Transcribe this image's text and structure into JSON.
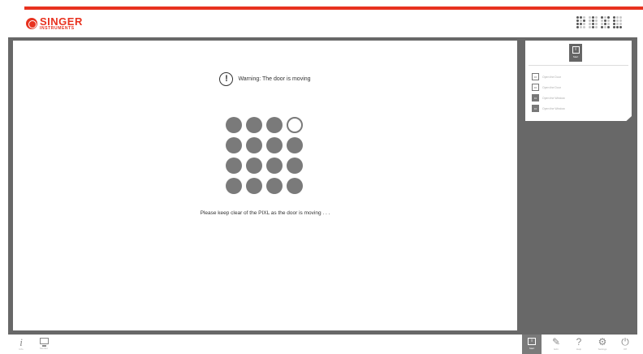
{
  "header": {
    "logo_brand": "SINGER",
    "logo_sub": "INSTRUMENTS",
    "product_logo": "PIXL"
  },
  "main": {
    "warning_icon": "exclamation-circle-icon",
    "warning_text": "Warning: The door is moving",
    "status_grid": {
      "rows": 4,
      "cols": 4,
      "empty_positions": [
        3
      ]
    },
    "message": "Please keep clear of the PIXL as the door is moving . . ."
  },
  "side_panel": {
    "tab_icon": "info-icon",
    "tab_label": "Start",
    "items": [
      {
        "label": "Open the Door",
        "icon": "plate-icon"
      },
      {
        "label": "Open the Door",
        "icon": "plate-icon"
      },
      {
        "label": "Open the Window",
        "icon": "plate-filled-icon"
      },
      {
        "label": "Open the Window",
        "icon": "plate-filled-icon"
      }
    ]
  },
  "bottom_bar": {
    "left": [
      {
        "label": "Info",
        "icon": "info-italic-icon"
      },
      {
        "label": "Monitor",
        "icon": "monitor-icon"
      }
    ],
    "right": [
      {
        "label": "Start",
        "icon": "info-square-icon",
        "active": true
      },
      {
        "label": "Edit",
        "icon": "pencil-icon",
        "active": false
      },
      {
        "label": "Help",
        "icon": "question-icon",
        "active": false
      },
      {
        "label": "Settings",
        "icon": "gear-icon",
        "active": false
      },
      {
        "label": "Off",
        "icon": "power-icon",
        "active": false
      }
    ]
  },
  "colors": {
    "accent": "#e8321f",
    "frame": "#686868",
    "dot": "#7a7a7a"
  }
}
